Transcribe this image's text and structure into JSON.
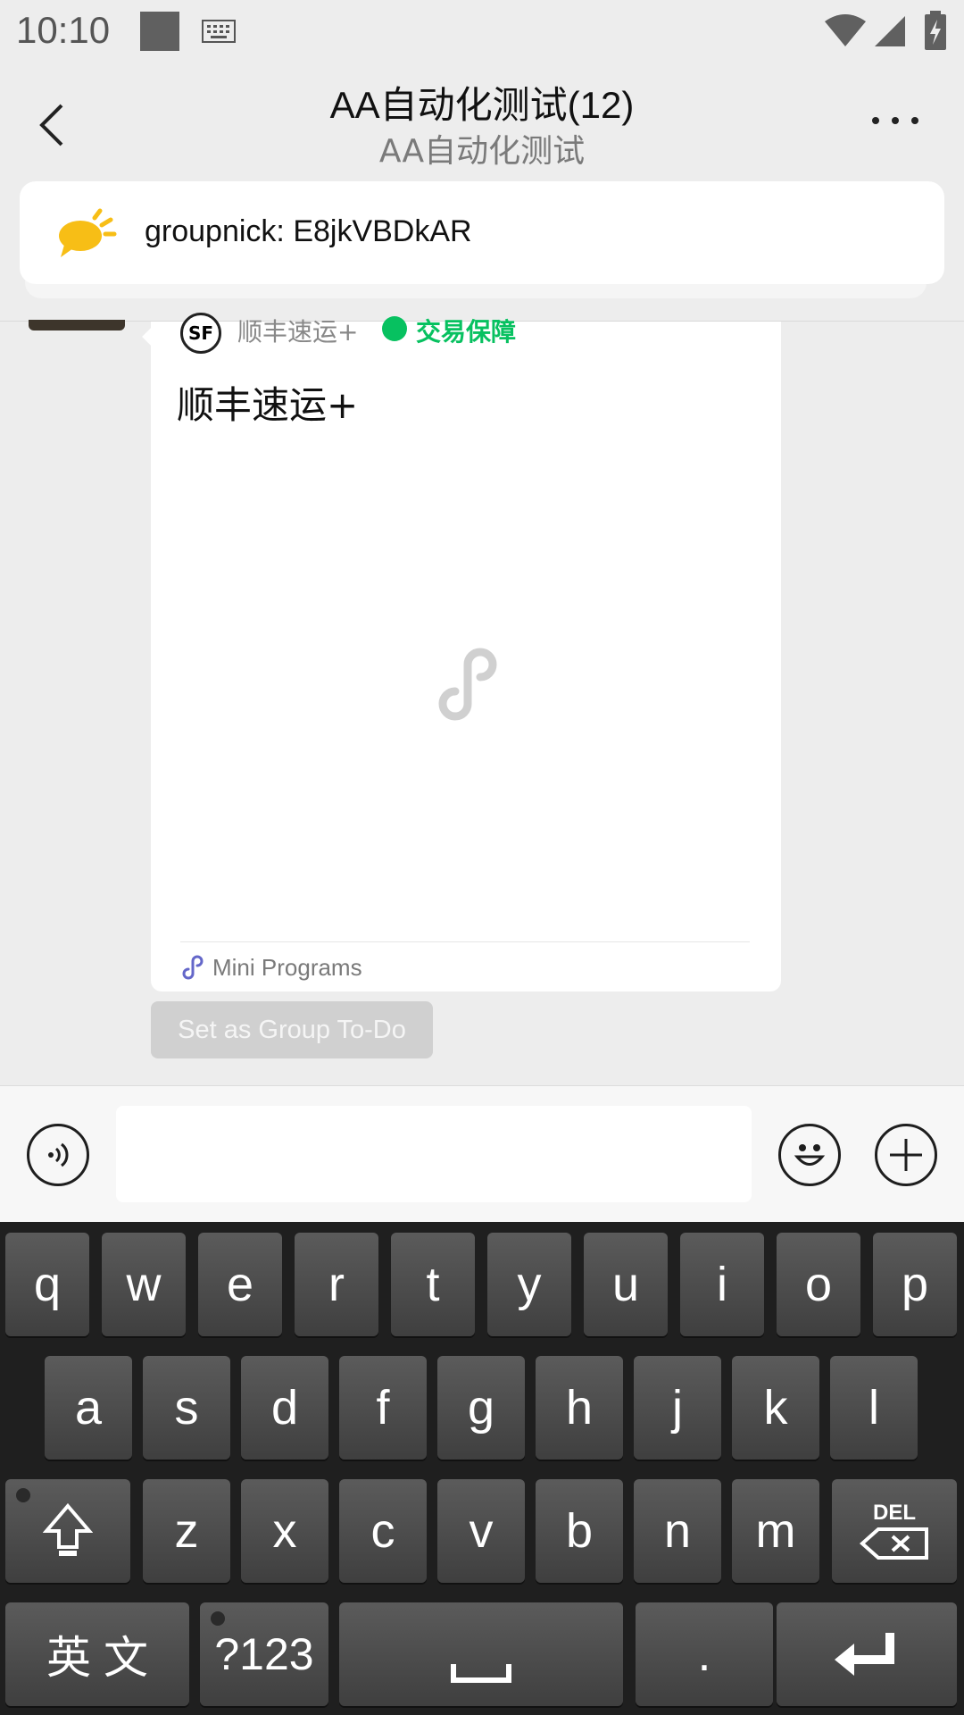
{
  "status_bar": {
    "time": "10:10"
  },
  "header": {
    "title": "AA自动化测试(12)",
    "subtitle": "AA自动化测试"
  },
  "notice": {
    "text": "groupnick: E8jkVBDkAR"
  },
  "message_card": {
    "app_name": "顺丰速运+",
    "trade_label": "交易保障",
    "logo_text": "SF",
    "title": "顺丰速运+",
    "footer_label": "Mini Programs"
  },
  "todo_button": {
    "label": "Set as Group To-Do"
  },
  "keyboard": {
    "row1": [
      "q",
      "w",
      "e",
      "r",
      "t",
      "y",
      "u",
      "i",
      "o",
      "p"
    ],
    "row2": [
      "a",
      "s",
      "d",
      "f",
      "g",
      "h",
      "j",
      "k",
      "l"
    ],
    "row3": [
      "z",
      "x",
      "c",
      "v",
      "b",
      "n",
      "m"
    ],
    "del_label": "DEL",
    "lang_label": "英 文",
    "symbols_label": "?123",
    "period_label": "."
  },
  "colors": {
    "accent_green": "#07c160",
    "background": "#ededed"
  }
}
